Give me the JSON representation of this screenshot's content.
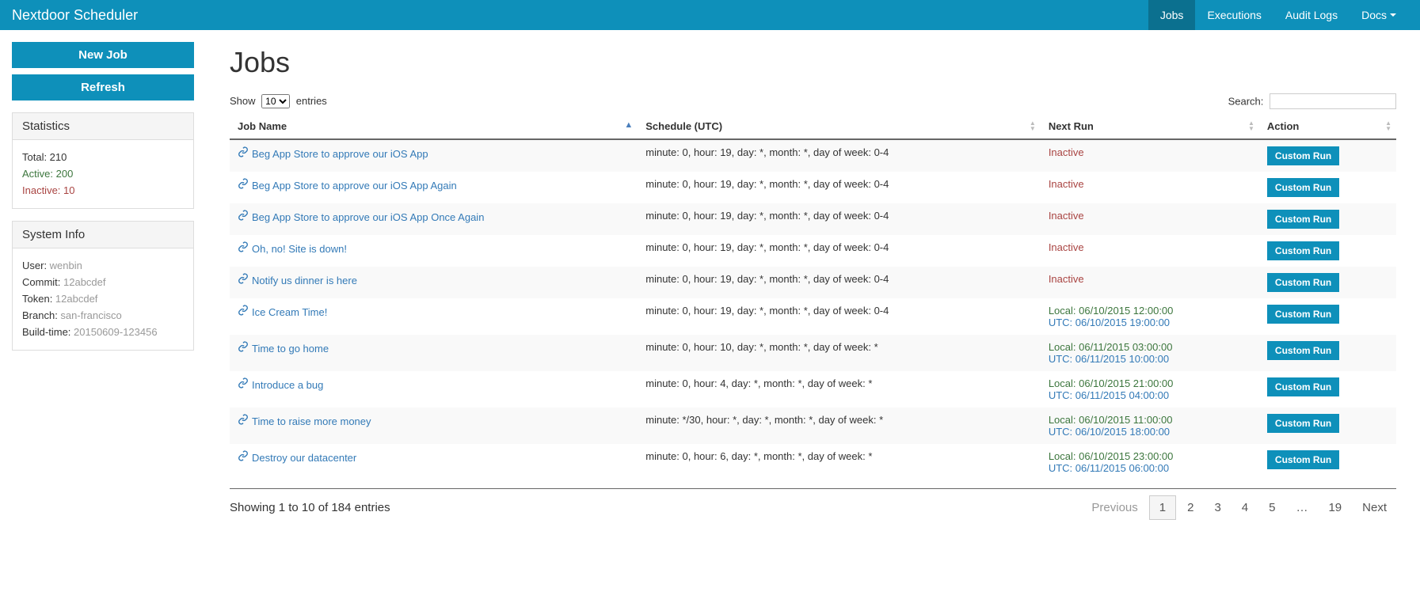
{
  "navbar": {
    "brand": "Nextdoor Scheduler",
    "items": [
      {
        "label": "Jobs",
        "active": true
      },
      {
        "label": "Executions",
        "active": false
      },
      {
        "label": "Audit Logs",
        "active": false
      },
      {
        "label": "Docs",
        "active": false,
        "dropdown": true
      }
    ]
  },
  "sidebar": {
    "new_job_label": "New Job",
    "refresh_label": "Refresh",
    "stats": {
      "heading": "Statistics",
      "total_label": "Total: 210",
      "active_label": "Active: 200",
      "inactive_label": "Inactive: 10"
    },
    "sysinfo": {
      "heading": "System Info",
      "rows": [
        {
          "label": "User:",
          "value": "wenbin"
        },
        {
          "label": "Commit:",
          "value": "12abcdef"
        },
        {
          "label": "Token:",
          "value": "12abcdef"
        },
        {
          "label": "Branch:",
          "value": "san-francisco"
        },
        {
          "label": "Build-time:",
          "value": "20150609-123456"
        }
      ]
    }
  },
  "main": {
    "title": "Jobs",
    "show_label_pre": "Show",
    "show_value": "10",
    "show_label_post": "entries",
    "search_label": "Search:",
    "columns": [
      {
        "label": "Job Name",
        "sort": "asc"
      },
      {
        "label": "Schedule (UTC)",
        "sort": "both"
      },
      {
        "label": "Next Run",
        "sort": "both"
      },
      {
        "label": "Action",
        "sort": "both"
      }
    ],
    "action_button_label": "Custom Run",
    "rows": [
      {
        "name": "Beg App Store to approve our iOS App",
        "schedule": "minute: 0, hour: 19, day: *, month: *, day of week: 0-4",
        "status": "inactive",
        "inactive_text": "Inactive"
      },
      {
        "name": "Beg App Store to approve our iOS App Again",
        "schedule": "minute: 0, hour: 19, day: *, month: *, day of week: 0-4",
        "status": "inactive",
        "inactive_text": "Inactive"
      },
      {
        "name": "Beg App Store to approve our iOS App Once Again",
        "schedule": "minute: 0, hour: 19, day: *, month: *, day of week: 0-4",
        "status": "inactive",
        "inactive_text": "Inactive"
      },
      {
        "name": "Oh, no! Site is down!",
        "schedule": "minute: 0, hour: 19, day: *, month: *, day of week: 0-4",
        "status": "inactive",
        "inactive_text": "Inactive"
      },
      {
        "name": "Notify us dinner is here",
        "schedule": "minute: 0, hour: 19, day: *, month: *, day of week: 0-4",
        "status": "inactive",
        "inactive_text": "Inactive"
      },
      {
        "name": "Ice Cream Time!",
        "schedule": "minute: 0, hour: 19, day: *, month: *, day of week: 0-4",
        "status": "active",
        "local": "Local: 06/10/2015 12:00:00",
        "utc": "UTC: 06/10/2015 19:00:00"
      },
      {
        "name": "Time to go home",
        "schedule": "minute: 0, hour: 10, day: *, month: *, day of week: *",
        "status": "active",
        "local": "Local: 06/11/2015 03:00:00",
        "utc": "UTC: 06/11/2015 10:00:00"
      },
      {
        "name": "Introduce a bug",
        "schedule": "minute: 0, hour: 4, day: *, month: *, day of week: *",
        "status": "active",
        "local": "Local: 06/10/2015 21:00:00",
        "utc": "UTC: 06/11/2015 04:00:00"
      },
      {
        "name": "Time to raise more money",
        "schedule": "minute: */30, hour: *, day: *, month: *, day of week: *",
        "status": "active",
        "local": "Local: 06/10/2015 11:00:00",
        "utc": "UTC: 06/10/2015 18:00:00"
      },
      {
        "name": "Destroy our datacenter",
        "schedule": "minute: 0, hour: 6, day: *, month: *, day of week: *",
        "status": "active",
        "local": "Local: 06/10/2015 23:00:00",
        "utc": "UTC: 06/11/2015 06:00:00"
      }
    ],
    "footer_info": "Showing 1 to 10 of 184 entries",
    "pagination": {
      "prev": "Previous",
      "next": "Next",
      "pages": [
        "1",
        "2",
        "3",
        "4",
        "5",
        "…",
        "19"
      ],
      "active": "1"
    }
  }
}
